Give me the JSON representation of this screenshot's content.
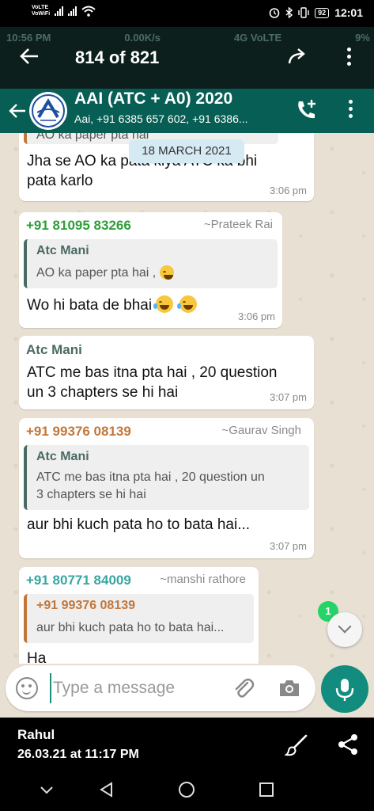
{
  "status_bar": {
    "volte_1": "VoLTE",
    "volte_2": "VoWiFi",
    "time": "12:01",
    "battery": "92"
  },
  "viewer": {
    "counter": "814 of 821",
    "ghost_time": "10:56 PM",
    "ghost_speed": "0.00K/s",
    "ghost_network": "4G VoLTE",
    "ghost_battery": "9%",
    "sender_name": "Rahul",
    "sent_at": "26.03.21 at 11:17 PM"
  },
  "chat_header": {
    "title": "AAI (ATC + A0) 2020",
    "subtitle": "Aai, +91 6385 657 602, +91 6386..."
  },
  "date_divider": "18 MARCH 2021",
  "messages": [
    {
      "quote_fragment": "AO ka paper pta hai",
      "text_line1": "Jha se AO ka pata kiya ATC ka bhi",
      "text_line2": "pata karlo",
      "time": "3:06 pm"
    },
    {
      "sender": "+91 81095 83266",
      "alias": "~Prateek Rai",
      "quote_name": "Atc Mani",
      "quote_text": "AO ka paper pta hai ,",
      "text": "Wo hi bata de bhai",
      "time": "3:06 pm"
    },
    {
      "sender": "Atc Mani",
      "text_line1": "ATC me bas itna pta hai , 20 question",
      "text_line2": "un 3 chapters se hi hai",
      "time": "3:07 pm"
    },
    {
      "sender": "+91 99376 08139",
      "alias": "~Gaurav Singh",
      "quote_name": "Atc Mani",
      "quote_line1": "ATC me bas itna pta hai , 20 question un",
      "quote_line2": "3 chapters se hi hai",
      "text": "aur bhi kuch pata ho to bata hai...",
      "time": "3:07 pm"
    },
    {
      "sender": "+91 80771 84009",
      "alias": "~manshi rathore",
      "quote_name": "+91 99376 08139",
      "quote_text": "aur bhi kuch pata ho to bata hai...",
      "text": "Ha"
    }
  ],
  "unread_badge": "1",
  "input": {
    "placeholder": "Type a message"
  },
  "colors": {
    "header": "#075e54",
    "accent": "#128c7e",
    "sender_prateek": "#2e9e3a",
    "sender_atc": "#4a6a64",
    "sender_gaurav": "#c2763a",
    "sender_manshi": "#3aa5a0"
  }
}
